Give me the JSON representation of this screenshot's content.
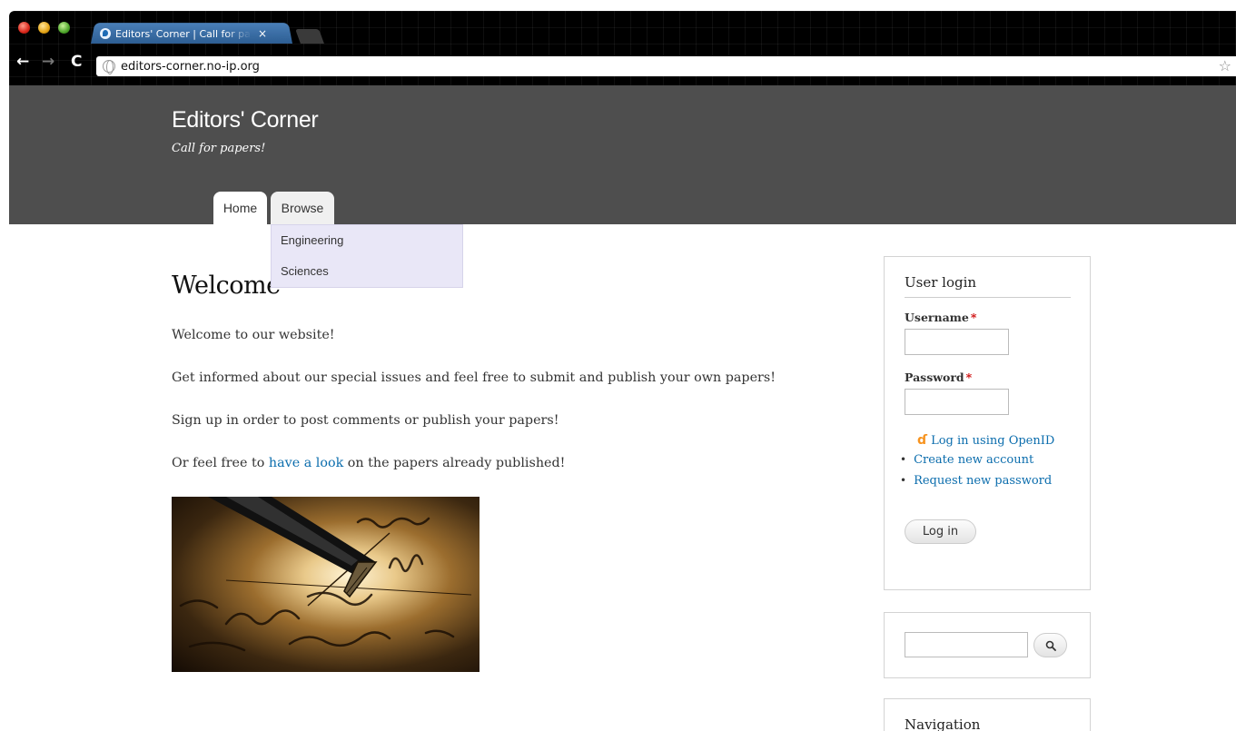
{
  "browser": {
    "tab_title": "Editors' Corner | Call for papers!",
    "tab_close": "×",
    "url": "editors-corner.no-ip.org",
    "icons": {
      "back": "back-arrow-icon",
      "forward": "forward-arrow-icon",
      "reload": "reload-icon",
      "site": "globe-icon",
      "bookmark": "star-icon"
    }
  },
  "site": {
    "name": "Editors' Corner",
    "slogan": "Call for papers!"
  },
  "menu": {
    "items": [
      {
        "label": "Home"
      },
      {
        "label": "Browse"
      }
    ],
    "browse_dropdown": [
      {
        "label": "Engineering"
      },
      {
        "label": "Sciences"
      }
    ]
  },
  "content": {
    "title": "Welcome",
    "p1": "Welcome to our website!",
    "p2": "Get informed about our special issues and feel free to submit and publish your own papers!",
    "p3": "Sign up in order to post comments or publish your papers!",
    "p4_before": "Or feel free to ",
    "p4_link": "have a look",
    "p4_after": " on the papers already published!"
  },
  "login_block": {
    "title": "User login",
    "username_label": "Username",
    "password_label": "Password",
    "required_mark": "*",
    "username_value": "",
    "password_value": "",
    "openid_link": "Log in using OpenID",
    "links": [
      "Create new account",
      "Request new password"
    ],
    "submit_label": "Log in"
  },
  "search_block": {
    "value": "",
    "button_icon": "search-icon"
  },
  "navigation_block": {
    "title": "Navigation"
  },
  "colors": {
    "header_bg": "#4e4e4e",
    "link": "#0b6dad",
    "dropdown_bg": "#e9e7f7",
    "tab_accent": "#2d5e93"
  }
}
